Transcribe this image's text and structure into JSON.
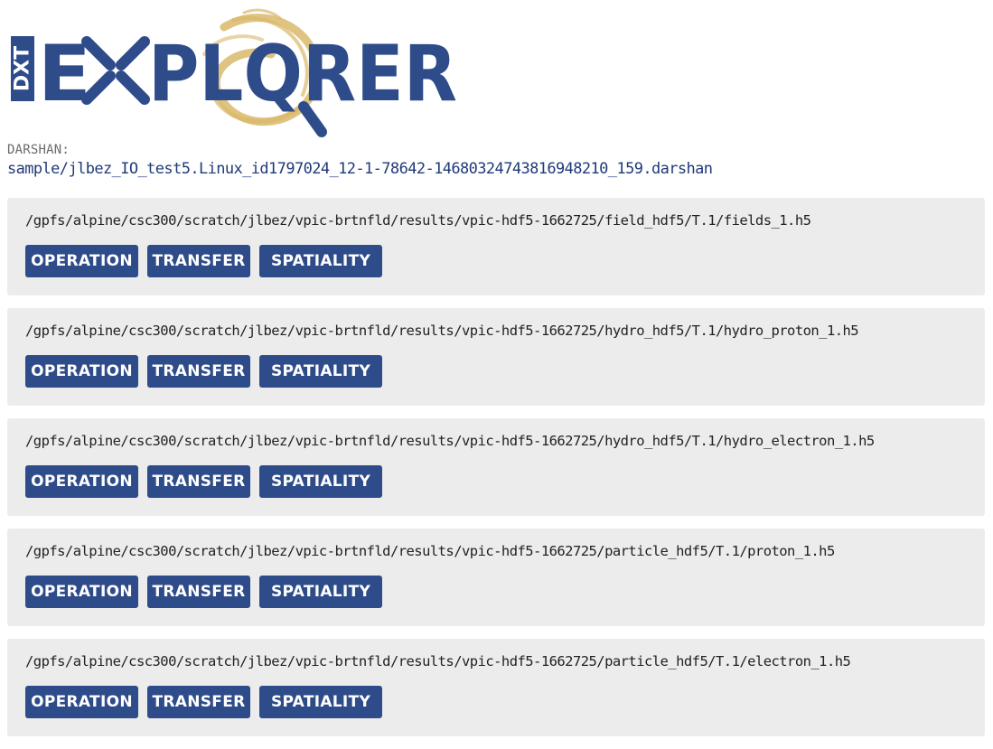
{
  "logo": {
    "badge_text": "DXT",
    "word_prefix": "E",
    "word_suffix": "PLQRER",
    "colors": {
      "navy": "#2e4b8a",
      "gold": "#d9b86a"
    }
  },
  "darshan": {
    "label": "DARSHAN:",
    "file": "sample/jlbez_IO_test5.Linux_id1797024_12-1-78642-14680324743816948210_159.darshan"
  },
  "buttons": {
    "operation": "OPERATION",
    "transfer": "TRANSFER",
    "spatiality": "SPATIALITY"
  },
  "files": [
    {
      "path": "/gpfs/alpine/csc300/scratch/jlbez/vpic-brtnfld/results/vpic-hdf5-1662725/field_hdf5/T.1/fields_1.h5"
    },
    {
      "path": "/gpfs/alpine/csc300/scratch/jlbez/vpic-brtnfld/results/vpic-hdf5-1662725/hydro_hdf5/T.1/hydro_proton_1.h5"
    },
    {
      "path": "/gpfs/alpine/csc300/scratch/jlbez/vpic-brtnfld/results/vpic-hdf5-1662725/hydro_hdf5/T.1/hydro_electron_1.h5"
    },
    {
      "path": "/gpfs/alpine/csc300/scratch/jlbez/vpic-brtnfld/results/vpic-hdf5-1662725/particle_hdf5/T.1/proton_1.h5"
    },
    {
      "path": "/gpfs/alpine/csc300/scratch/jlbez/vpic-brtnfld/results/vpic-hdf5-1662725/particle_hdf5/T.1/electron_1.h5"
    }
  ],
  "colors": {
    "accent": "#2e4b8a",
    "card_bg": "#ececec",
    "link": "#1f3a7a"
  }
}
